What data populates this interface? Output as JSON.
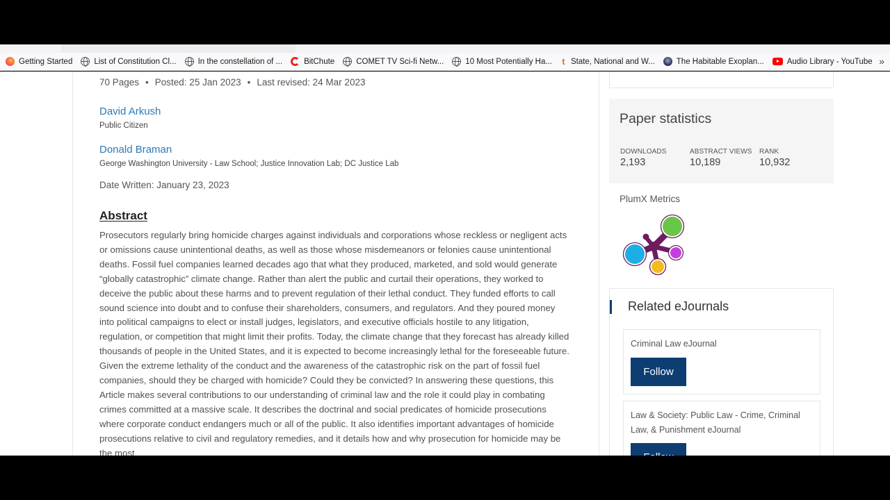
{
  "bookmarks": {
    "items": [
      {
        "label": "Getting Started",
        "icon": "firefox-icon"
      },
      {
        "label": "List of Constitution Cl...",
        "icon": "globe-icon"
      },
      {
        "label": "In the constellation of ...",
        "icon": "globe-icon"
      },
      {
        "label": "BitChute",
        "icon": "bitchute-icon"
      },
      {
        "label": "COMET TV Sci-fi Netw...",
        "icon": "globe-icon"
      },
      {
        "label": "10 Most Potentially Ha...",
        "icon": "globe-icon"
      },
      {
        "label": "State, National and W...",
        "icon": "tumblr-icon"
      },
      {
        "label": "The Habitable Exoplan...",
        "icon": "exoplanet-icon"
      },
      {
        "label": "Audio Library - YouTube",
        "icon": "youtube-icon"
      }
    ],
    "more": "»"
  },
  "paper": {
    "meta": {
      "pages": "70 Pages",
      "posted": "Posted: 25 Jan 2023",
      "revised": "Last revised: 24 Mar 2023",
      "separator": "•"
    },
    "authors": [
      {
        "name": "David Arkush",
        "affiliation": "Public Citizen"
      },
      {
        "name": "Donald Braman",
        "affiliation": "George Washington University - Law School; Justice Innovation Lab; DC Justice Lab"
      }
    ],
    "date_written": "Date Written: January 23, 2023",
    "abstract_heading": "Abstract",
    "abstract": "Prosecutors regularly bring homicide charges against individuals and corporations whose reckless or negligent acts or omissions cause unintentional deaths, as well as those whose misdemeanors or felonies cause unintentional deaths. Fossil fuel companies learned decades ago that what they produced, marketed, and sold would generate “globally catastrophic” climate change. Rather than alert the public and curtail their operations, they worked to deceive the public about these harms and to prevent regulation of their lethal conduct. They funded efforts to call sound science into doubt and to confuse their shareholders, consumers, and regulators. And they poured money into political campaigns to elect or install judges, legislators, and executive officials hostile to any litigation, regulation, or competition that might limit their profits. Today, the climate change that they forecast has already killed thousands of people in the United States, and it is expected to become increasingly lethal for the foreseeable future. Given the extreme lethality of the conduct and the awareness of the catastrophic risk on the part of fossil fuel companies, should they be charged with homicide? Could they be convicted? In answering these questions, this Article makes several contributions to our understanding of criminal law and the role it could play in combating crimes committed at a massive scale. It describes the doctrinal and social predicates of homicide prosecutions where corporate conduct endangers much or all of the public. It also identifies important advantages of homicide prosecutions relative to civil and regulatory remedies, and it details how and why prosecution for homicide may be the most"
  },
  "sidebar": {
    "stats": {
      "title": "Paper statistics",
      "items": [
        {
          "label": "DOWNLOADS",
          "value": "2,193"
        },
        {
          "label": "ABSTRACT VIEWS",
          "value": "10,189"
        },
        {
          "label": "RANK",
          "value": "10,932"
        }
      ]
    },
    "plumx_label": "PlumX Metrics",
    "related": {
      "title": "Related eJournals",
      "journals": [
        {
          "name": "Criminal Law eJournal",
          "button": "Follow"
        },
        {
          "name": "Law & Society: Public Law - Crime, Criminal Law, & Punishment eJournal",
          "button": "Follow"
        }
      ]
    },
    "colors": {
      "brand": "#0e3d72",
      "link": "#2a7ab8"
    }
  }
}
